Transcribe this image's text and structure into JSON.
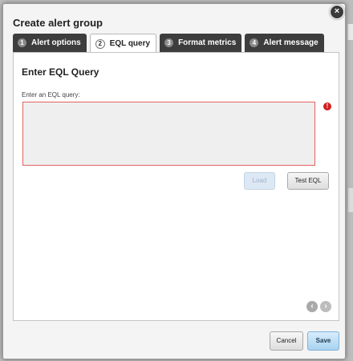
{
  "dialog": {
    "title": "Create alert group",
    "close_icon": "close-icon"
  },
  "tabs": [
    {
      "number": "1",
      "label": "Alert options",
      "active": false
    },
    {
      "number": "2",
      "label": "EQL query",
      "active": true
    },
    {
      "number": "3",
      "label": "Format metrics",
      "active": false
    },
    {
      "number": "4",
      "label": "Alert message",
      "active": false
    }
  ],
  "panel": {
    "heading": "Enter EQL Query",
    "query_label": "Enter an EQL query:",
    "query_value": "",
    "error_icon": "exclamation-icon",
    "load_label": "Load",
    "test_label": "Test EQL",
    "pager": {
      "prev_icon": "chevron-left-icon",
      "next_icon": "chevron-right-icon"
    }
  },
  "footer": {
    "cancel_label": "Cancel",
    "save_label": "Save"
  },
  "colors": {
    "tab_dark": "#3d3d3d",
    "error_border": "#e06262",
    "error_icon": "#d21f1f",
    "save_button": "#a9d3f0"
  }
}
